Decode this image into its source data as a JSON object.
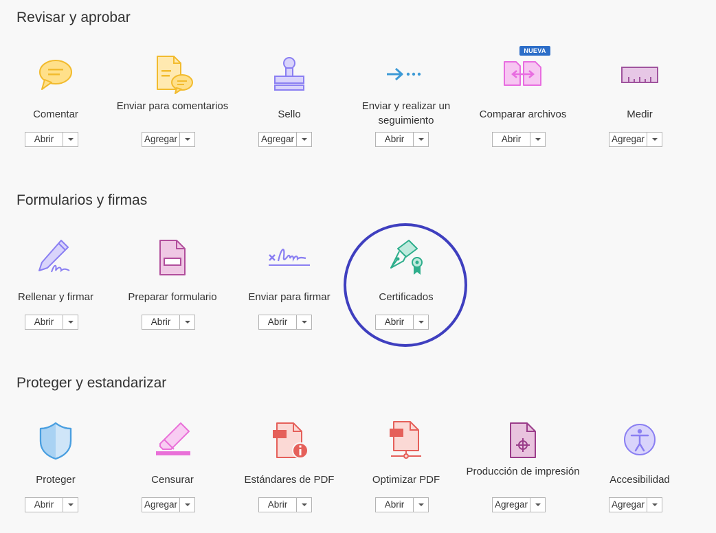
{
  "sections": [
    {
      "title": "Revisar y aprobar",
      "badge": "NUEVA",
      "tools": [
        {
          "name": "Comentar",
          "button": "Abrir"
        },
        {
          "name": "Enviar para comentarios",
          "button": "Agregar"
        },
        {
          "name": "Sello",
          "button": "Agregar"
        },
        {
          "name": "Enviar y realizar un seguimiento",
          "button": "Abrir"
        },
        {
          "name": "Comparar archivos",
          "button": "Abrir"
        },
        {
          "name": "Medir",
          "button": "Agregar"
        }
      ]
    },
    {
      "title": "Formularios y firmas",
      "tools": [
        {
          "name": "Rellenar y firmar",
          "button": "Abrir"
        },
        {
          "name": "Preparar formulario",
          "button": "Abrir"
        },
        {
          "name": "Enviar para firmar",
          "button": "Abrir"
        },
        {
          "name": "Certificados",
          "button": "Abrir"
        }
      ]
    },
    {
      "title": "Proteger y estandarizar",
      "tools": [
        {
          "name": "Proteger",
          "button": "Abrir"
        },
        {
          "name": "Censurar",
          "button": "Agregar"
        },
        {
          "name": "Estándares de PDF",
          "button": "Abrir"
        },
        {
          "name": "Optimizar PDF",
          "button": "Abrir"
        },
        {
          "name": "Producción de impresión",
          "button": "Agregar"
        },
        {
          "name": "Accesibilidad",
          "button": "Agregar"
        }
      ]
    }
  ],
  "icons": {
    "comment": "comment-icon",
    "send_comments": "send-for-comments-icon",
    "stamp": "stamp-icon",
    "send_track": "send-and-track-icon",
    "compare": "compare-files-icon",
    "measure": "measure-icon",
    "fill_sign": "fill-and-sign-icon",
    "prepare_form": "prepare-form-icon",
    "send_sign": "send-for-signature-icon",
    "certificates": "certificates-icon",
    "protect": "protect-icon",
    "redact": "redact-icon",
    "pdf_standards": "pdf-standards-icon",
    "optimize": "optimize-pdf-icon",
    "print_production": "print-production-icon",
    "accessibility": "accessibility-icon"
  },
  "colors": {
    "comment_yellow": "#f7c948",
    "stamp_purple": "#8a7ff2",
    "send_blue": "#3d9ad6",
    "compare_pink": "#e86de0",
    "measure_purple": "#a0549e",
    "fill_sign_purple": "#8a7ff2",
    "form_magenta": "#b14e9c",
    "cert_green": "#2fae8c",
    "protect_blue": "#4a9fe0",
    "redact_pink": "#e970d8",
    "pdf_red": "#e5605a",
    "print_plum": "#9b3d8a",
    "access_purple": "#8a7ff2",
    "badge_blue": "#2d6ec8",
    "highlight_circle": "#3f3fbf"
  }
}
